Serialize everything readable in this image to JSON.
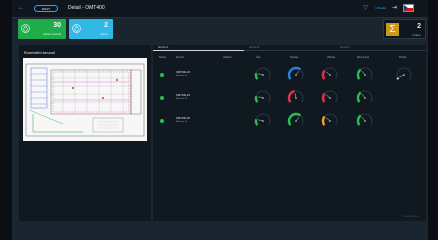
{
  "header": {
    "back_icon": "arrow-left-icon",
    "logo_text": "ENVI",
    "title": "Detail - OMT400",
    "user_label": "Uživatel",
    "icons": [
      "filter-icon",
      "logout-icon",
      "cz-flag-icon"
    ]
  },
  "kpis": [
    {
      "value": "30",
      "label": "Celkem senzorů",
      "color": "#1fad4c",
      "icon": "drop-icon"
    },
    {
      "value": "2",
      "label": "Aktivní",
      "color": "#31b8e4",
      "icon": "drop-icon"
    }
  ],
  "summary": {
    "value": "2",
    "label": "Celkem",
    "icon": "sigma-icon",
    "color": "#c89a1c"
  },
  "left_panel": {
    "title": "Rozmístění senzorů"
  },
  "right_panel": {
    "tabs": [
      {
        "label": "Senzor A",
        "active": true
      },
      {
        "label": "Senzor B",
        "active": false
      },
      {
        "label": "Senzor C",
        "active": false
      }
    ],
    "columns": [
      "Status",
      "Senzor",
      "Událost",
      "Čas",
      "Teplota",
      "Vlhkost",
      "Rosný bod",
      "Průtok"
    ],
    "rows": [
      {
        "status": "online",
        "name": "OMT400-23",
        "location": "Místnost 01",
        "gauges": [
          {
            "v": 0.2,
            "c": "#27c04f"
          },
          {
            "v": 0.65,
            "c": "#2a7de1"
          },
          {
            "v": 0.3,
            "c": "#e0314f"
          },
          {
            "v": 0.35,
            "c": "#27c04f"
          },
          {
            "v": 0.05,
            "c": "#cfd6de"
          }
        ]
      },
      {
        "status": "online",
        "name": "OMT400-24",
        "location": "Místnost 02",
        "gauges": [
          {
            "v": 0.2,
            "c": "#27c04f"
          },
          {
            "v": 0.45,
            "c": "#e0314f"
          },
          {
            "v": 0.3,
            "c": "#e0314f"
          },
          {
            "v": 0.35,
            "c": "#27c04f"
          }
        ]
      },
      {
        "status": "online",
        "name": "OMT400-25",
        "location": "Místnost 03",
        "gauges": [
          {
            "v": 0.2,
            "c": "#27c04f"
          },
          {
            "v": 0.65,
            "c": "#27c04f"
          },
          {
            "v": 0.3,
            "c": "#f0a21c"
          },
          {
            "v": 0.35,
            "c": "#27c04f"
          }
        ]
      }
    ]
  },
  "footer": {
    "text": "© 2022 ENVI s.r.o."
  }
}
